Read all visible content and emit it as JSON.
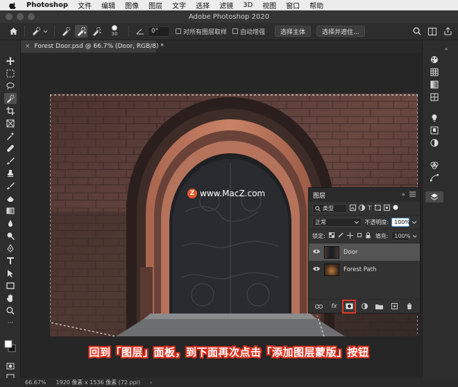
{
  "menubar": {
    "app": "Photoshop",
    "items": [
      "文件",
      "编辑",
      "图像",
      "图层",
      "文字",
      "选择",
      "滤镜",
      "3D",
      "视图",
      "窗口",
      "帮助"
    ]
  },
  "window": {
    "title": "Adobe Photoshop 2020"
  },
  "options_bar": {
    "brush_size": "30",
    "angle": "0°",
    "sample_all_layers": "对所有图层取样",
    "auto_enhance": "自动增强",
    "select_subject": "选择主体",
    "select_and_mask": "选择并遮住..."
  },
  "document_tab": {
    "close": "×",
    "label": "Forest Door.psd @ 66.7% (Door, RGB/8) *"
  },
  "layers_panel": {
    "title": "图层",
    "filter_kind": "类型",
    "blend_mode": "正常",
    "opacity_label": "不透明度:",
    "opacity_value": "100%",
    "lock_label": "锁定:",
    "fill_label": "填充:",
    "fill_value": "100%",
    "layers": [
      {
        "name": "Door",
        "selected": true,
        "visible": true
      },
      {
        "name": "Forest Path",
        "selected": false,
        "visible": true
      }
    ],
    "footer_icons": [
      "link-icon",
      "fx-icon",
      "add-layer-mask-icon",
      "adjustment-icon",
      "group-folder-icon",
      "new-layer-icon",
      "trash-icon"
    ],
    "highlighted_button": "add-layer-mask-icon",
    "fx_label": "fx"
  },
  "watermark": {
    "logo": "Z",
    "text": "www.MacZ.com"
  },
  "caption": {
    "text": "回到「图层」面板，到下面再次点击「添加图层蒙版」按钮"
  },
  "status_bar": {
    "zoom": "66.67%",
    "doc_info": "1920 像素 x 1536 像素 (72 ppi)"
  },
  "colors": {
    "highlight": "#e53a26",
    "caption_outline": "#e0301d",
    "ps_dark": "#262626"
  }
}
